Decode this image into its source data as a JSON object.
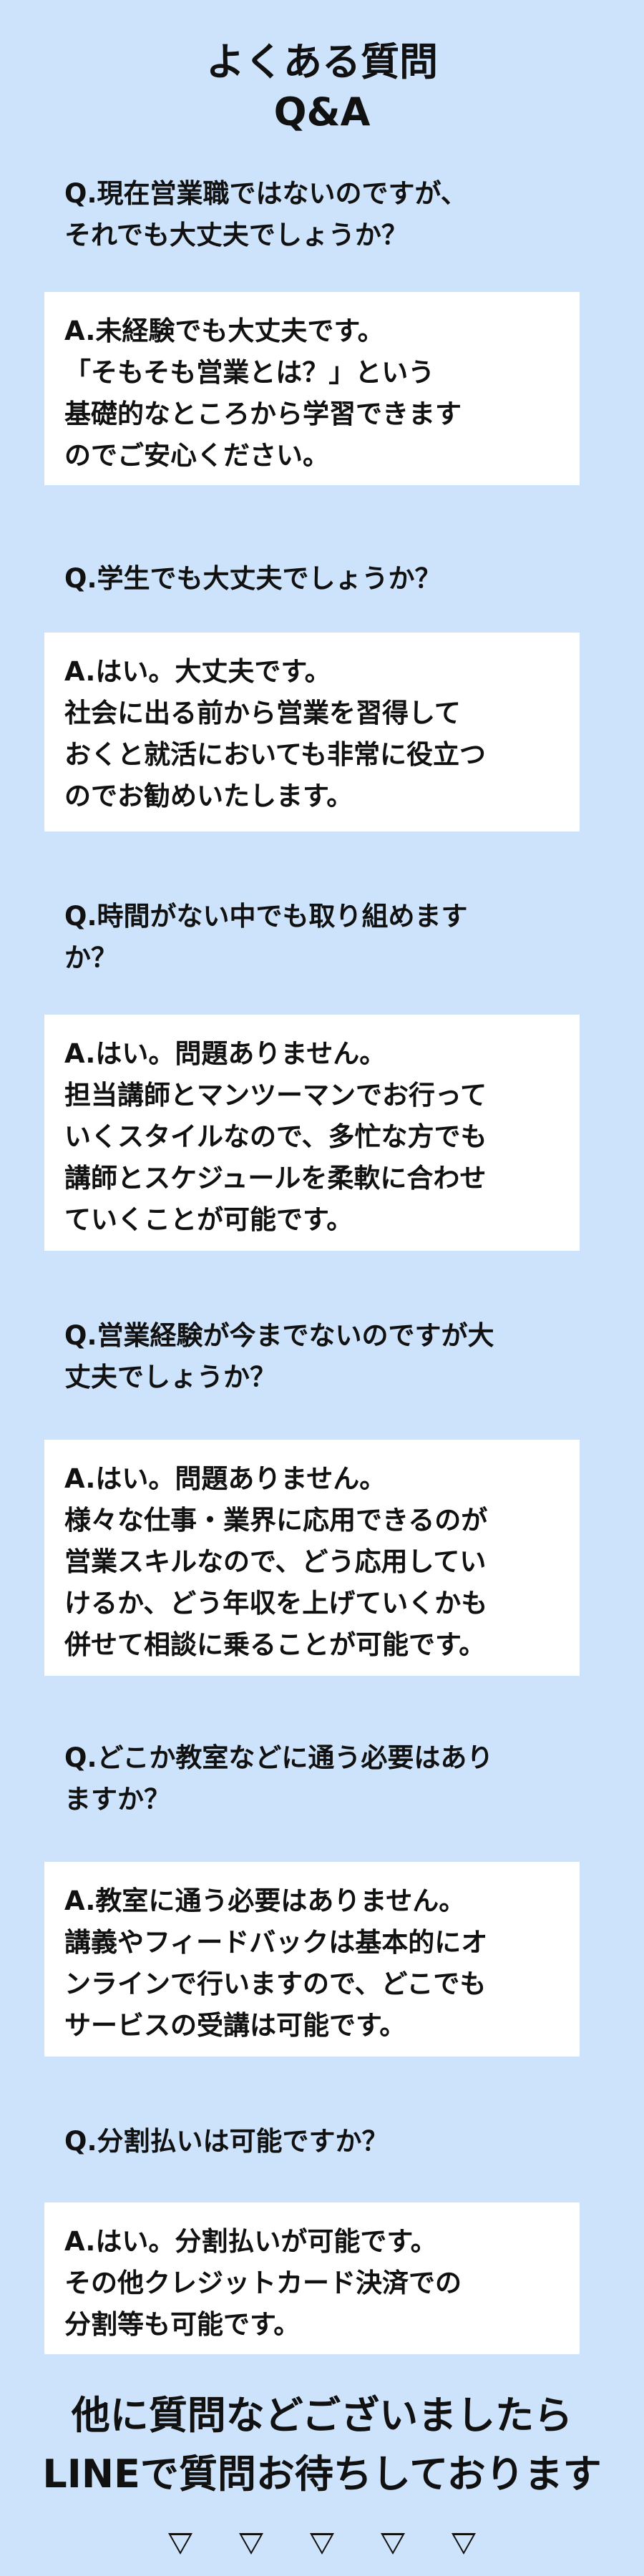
{
  "header": {
    "title": "よくある質問",
    "subtitle": "Q&A"
  },
  "faq": [
    {
      "question": "Q.現在営業職ではないのですが、\nそれでも大丈夫でしょうか？",
      "answer": "A.未経験でも大丈夫です。\n「そもそも営業とは？」という\n基礎的なところから学習できます\nのでご安心ください。"
    },
    {
      "question": "Q.学生でも大丈夫でしょうか？",
      "answer": "A.はい。大丈夫です。\n社会に出る前から営業を習得して\nおくと就活においても非常に役立つ\nのでお勧めいたします。"
    },
    {
      "question": "Q.時間がない中でも取り組めます\nか？",
      "answer": "A.はい。問題ありません。\n担当講師とマンツーマンでお行って\nいくスタイルなので、多忙な方でも\n講師とスケジュールを柔軟に合わせ\nていくことが可能です。"
    },
    {
      "question": "Q.営業経験が今までないのですが大\n丈夫でしょうか？",
      "answer": "A.はい。問題ありません。\n様々な仕事・業界に応用できるのが\n営業スキルなので、どう応用してい\nけるか、どう年収を上げていくかも\n併せて相談に乗ることが可能です。"
    },
    {
      "question": "Q.どこか教室などに通う必要はあり\nますか？",
      "answer": "A.教室に通う必要はありません。\n講義やフィードバックは基本的にオ\nンラインで行いますので、どこでも\nサービスの受講は可能です。"
    },
    {
      "question": "Q.分割払いは可能ですか？",
      "answer": "A.はい。分割払いが可能です。\nその他クレジットカード決済での\n分割等も可能です。"
    }
  ],
  "footer": {
    "line1": "他に質問などございましたら",
    "line2": "LINEで質問お待ちしております"
  },
  "icons": {
    "arrow": "down-triangle-outline-icon",
    "count": 5
  },
  "colors": {
    "background": "#cde3fb",
    "card": "#ffffff",
    "text": "#111111"
  }
}
